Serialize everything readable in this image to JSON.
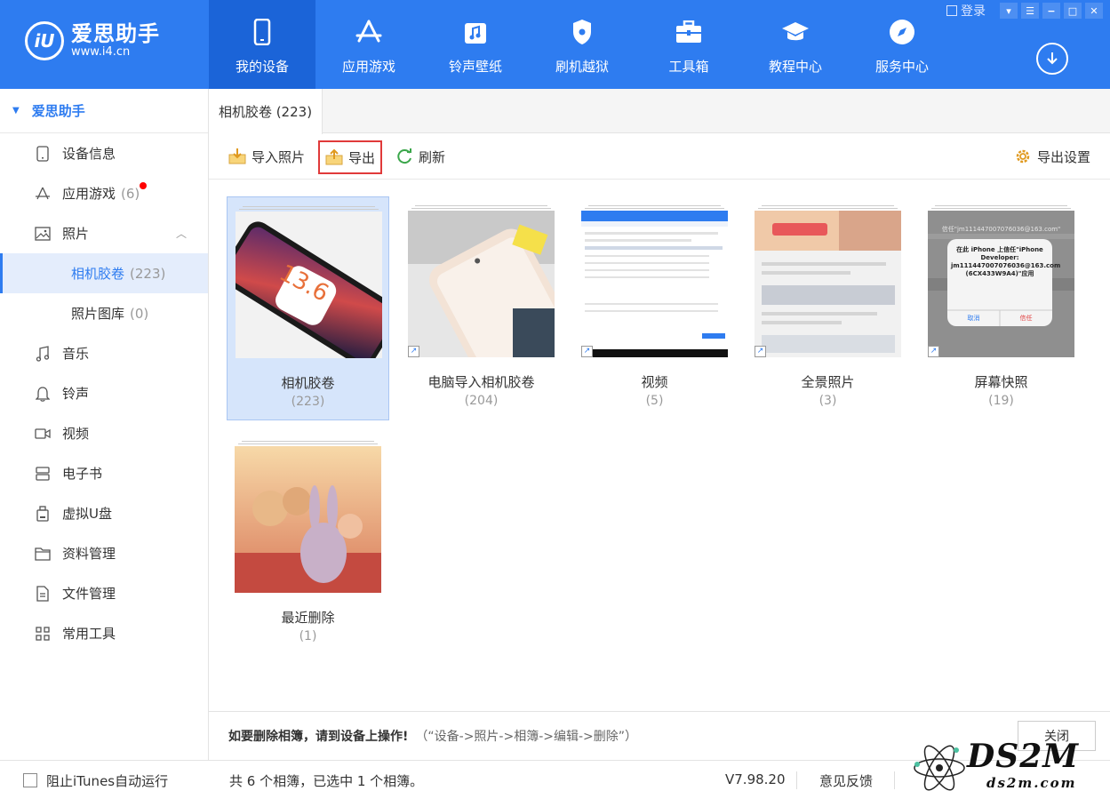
{
  "app": {
    "name": "爱思助手",
    "url": "www.i4.cn",
    "logo_mark": "iU"
  },
  "nav": [
    {
      "label": "我的设备",
      "icon": "phone-icon"
    },
    {
      "label": "应用游戏",
      "icon": "app-store-icon"
    },
    {
      "label": "铃声壁纸",
      "icon": "music-note-icon"
    },
    {
      "label": "刷机越狱",
      "icon": "shield-icon"
    },
    {
      "label": "工具箱",
      "icon": "toolbox-icon"
    },
    {
      "label": "教程中心",
      "icon": "graduation-cap-icon"
    },
    {
      "label": "服务中心",
      "icon": "compass-icon"
    }
  ],
  "window": {
    "login": "登录"
  },
  "sidebar": {
    "root": "爱思助手",
    "items": [
      {
        "label": "设备信息"
      },
      {
        "label": "应用游戏",
        "count": "(6)"
      },
      {
        "label": "照片"
      },
      {
        "label": "相机胶卷",
        "count": "(223)"
      },
      {
        "label": "照片图库",
        "count": "(0)"
      },
      {
        "label": "音乐"
      },
      {
        "label": "铃声"
      },
      {
        "label": "视频"
      },
      {
        "label": "电子书"
      },
      {
        "label": "虚拟U盘"
      },
      {
        "label": "资料管理"
      },
      {
        "label": "文件管理"
      },
      {
        "label": "常用工具"
      }
    ]
  },
  "tab": {
    "label": "相机胶卷 (223)"
  },
  "toolbar": {
    "import": "导入照片",
    "export": "导出",
    "refresh": "刷新",
    "export_settings": "导出设置"
  },
  "albums": [
    {
      "name": "相机胶卷",
      "count": "(223)"
    },
    {
      "name": "电脑导入相机胶卷",
      "count": "(204)"
    },
    {
      "name": "视频",
      "count": "(5)"
    },
    {
      "name": "全景照片",
      "count": "(3)"
    },
    {
      "name": "屏幕快照",
      "count": "(19)"
    },
    {
      "name": "最近删除",
      "count": "(1)"
    }
  ],
  "thumb_text": {
    "ios_version": "13.6",
    "dialog_title": "信任\"jm111447007076036@163.com\"",
    "dialog_body": "在此 iPhone 上信任\"iPhone Developer: jm111447007076036@163.com (6CX433W9A4)\"应用",
    "dialog_cancel": "取消",
    "dialog_trust": "信任"
  },
  "notice": {
    "main": "如要删除相簿，请到设备上操作!",
    "hint": "（“设备->照片->相簿->编辑->删除”）",
    "close": "关闭"
  },
  "status": {
    "itunes": "阻止iTunes自动运行",
    "summary": "共 6 个相簿，已选中 1 个相簿。",
    "version": "V7.98.20",
    "feedback": "意见反馈"
  },
  "watermark": {
    "text": "DS2M",
    "sub": "ds2m.com"
  },
  "colors": {
    "primary": "#2e7cf0",
    "active_nav": "#1b64d8",
    "selected_bg": "#d6e5fb",
    "highlight": "#e03a3a"
  }
}
